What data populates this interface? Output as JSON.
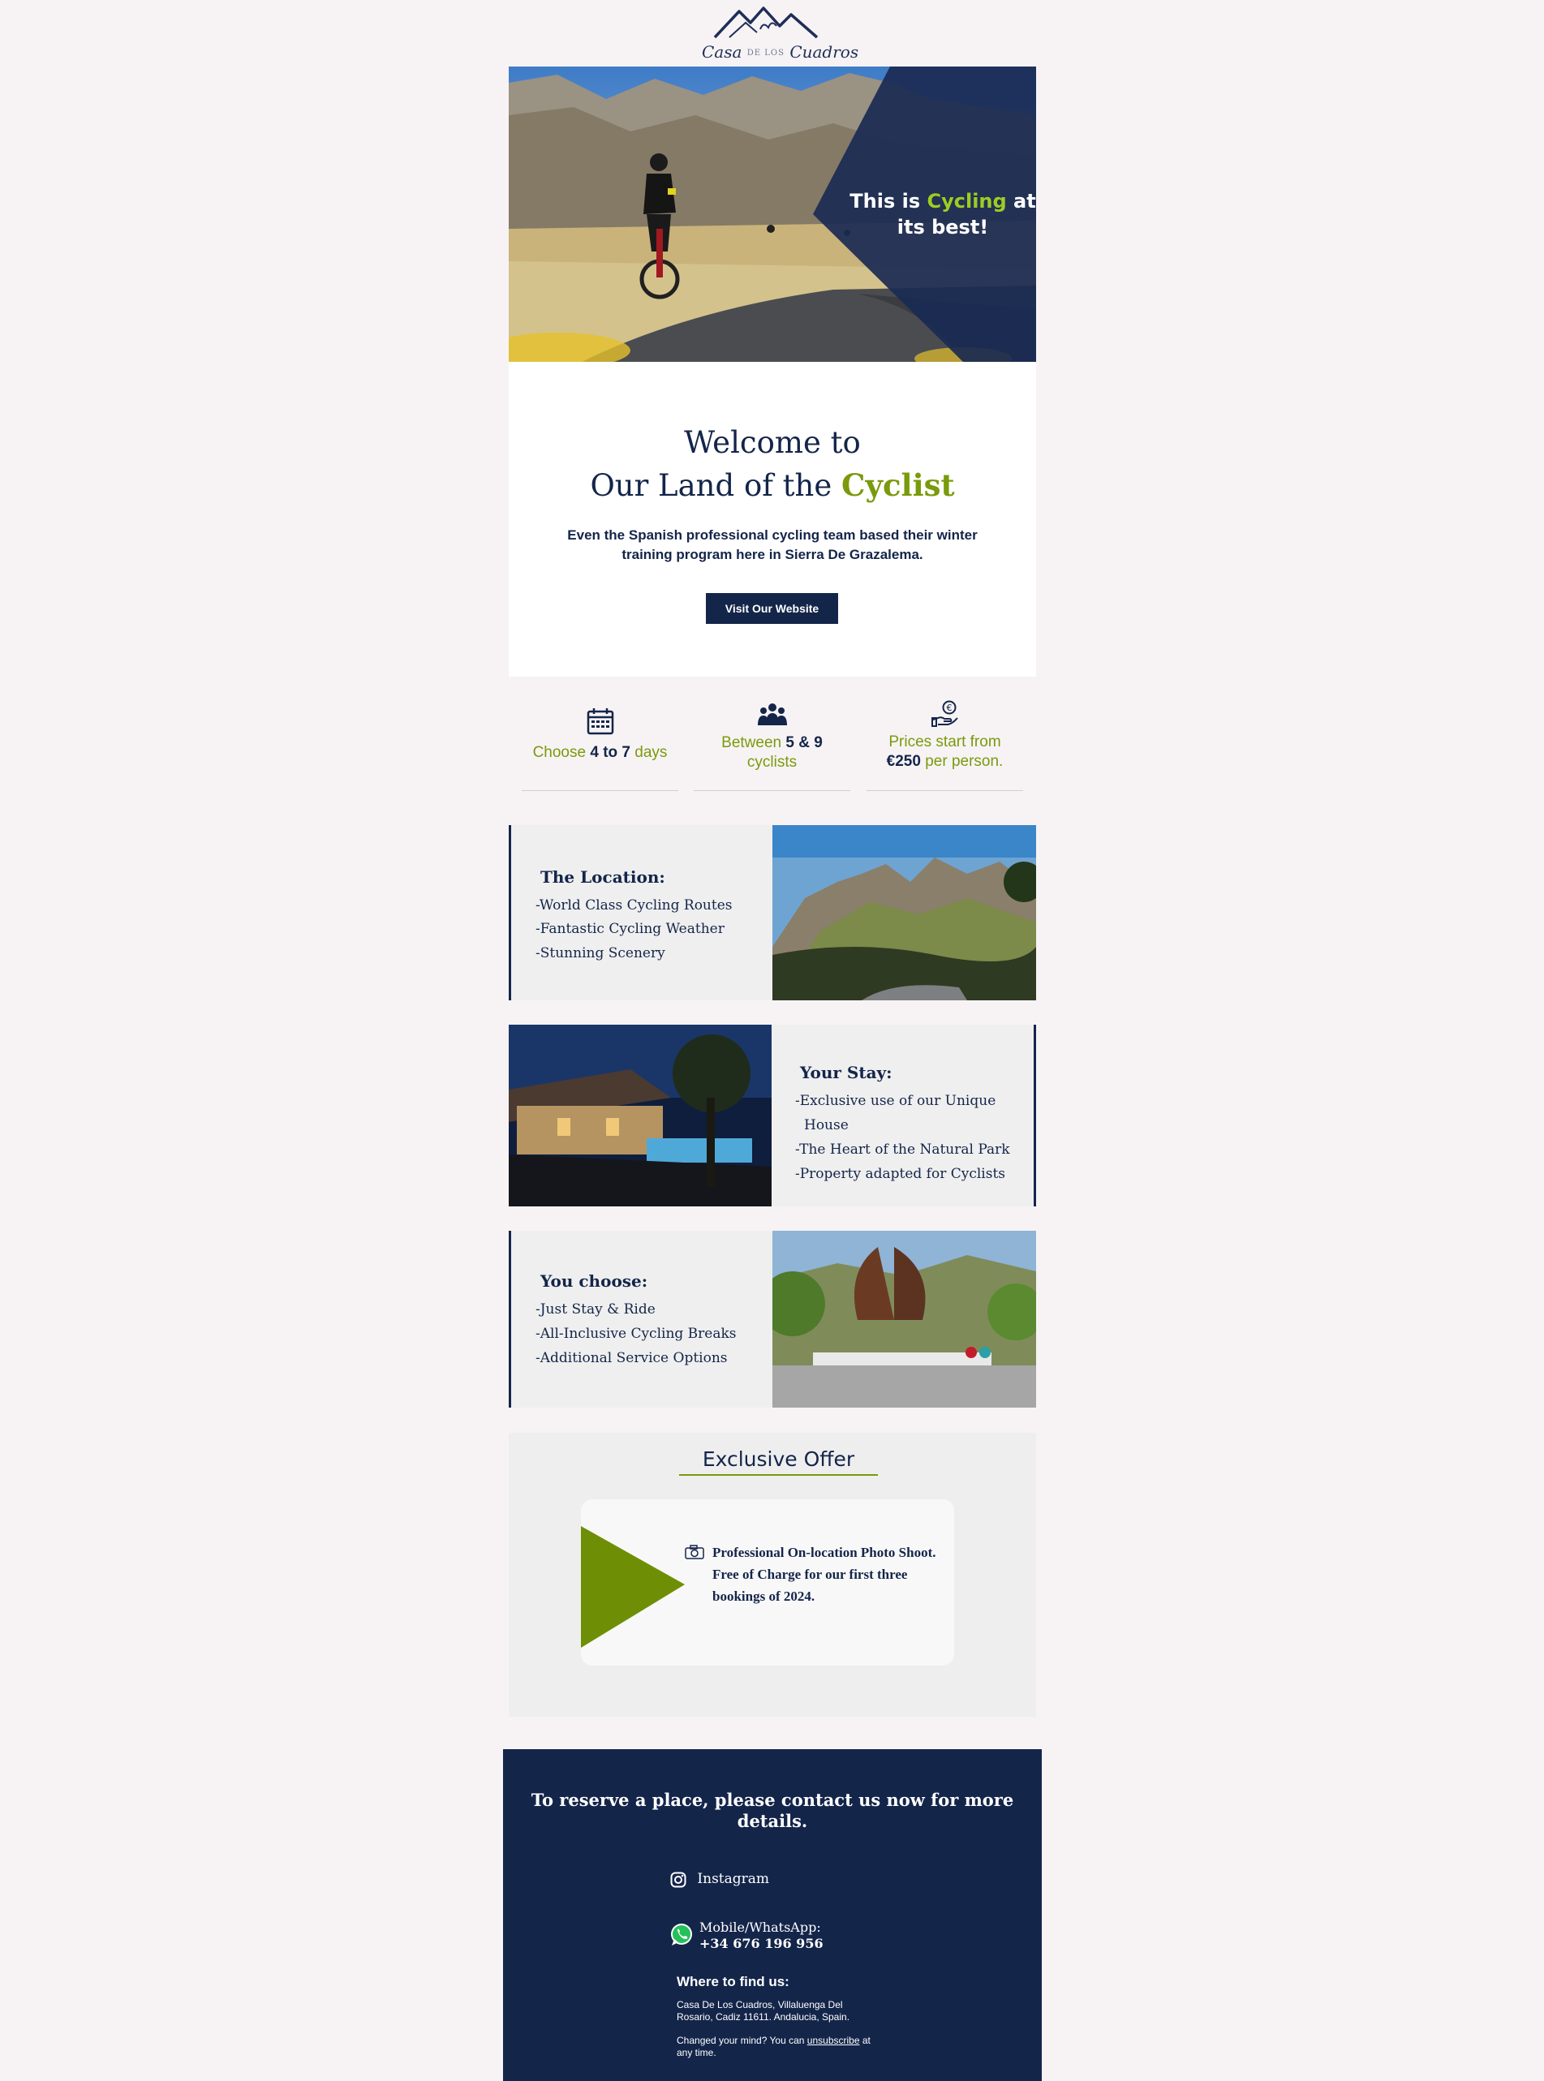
{
  "header": {
    "brand_left": "Casa",
    "brand_mid": "DE LOS",
    "brand_right": "Cuadros"
  },
  "hero": {
    "line_a": "This is ",
    "accent": "Cycling",
    "line_b": " at its best!"
  },
  "welcome": {
    "title_line1": "Welcome to",
    "title_line2": "Our Land of the ",
    "title_accent": "Cyclist",
    "body": "Even the Spanish professional cycling team based their winter training program here in Sierra De Grazalema.",
    "button": "Visit Our Website"
  },
  "features": [
    {
      "icon": "calendar-icon",
      "pre": "Choose ",
      "b1": "4",
      "mid": " to ",
      "b2": "7",
      "post": " days"
    },
    {
      "icon": "group-icon",
      "pre": "Between ",
      "b1": "5",
      "mid": " & ",
      "b2": "9",
      "post": "cyclists"
    },
    {
      "icon": "euro-hand-icon",
      "pre": "Prices start from",
      "b1": "€250",
      "post": " per person."
    }
  ],
  "location": {
    "title": "The Location:",
    "items": [
      "-World Class Cycling Routes",
      "-Fantastic Cycling Weather",
      "-Stunning Scenery"
    ]
  },
  "stay": {
    "title": "Your Stay:",
    "items": [
      "-Exclusive use of our Unique",
      "House",
      "-The Heart of the Natural Park",
      "-Property adapted for Cyclists"
    ]
  },
  "choose": {
    "title": "You choose:",
    "items": [
      "-Just Stay & Ride",
      "-All-Inclusive Cycling Breaks",
      "-Additional Service Options"
    ]
  },
  "offer": {
    "title": "Exclusive Offer",
    "text": "Professional On-location Photo Shoot. Free of Charge for our first three bookings of 2024."
  },
  "footer": {
    "cta": "To reserve a place, please contact us now for more details.",
    "instagram": "Instagram",
    "phone_label": "Mobile/WhatsApp:",
    "phone": "+34 676 196 956",
    "where_title": "Where to find us:",
    "address": "Casa De Los Cuadros, Villaluenga Del Rosario, Cadiz 11611. Andalucia, Spain.",
    "unsub_pre": "Changed your mind? You can ",
    "unsub_link": "unsubscribe",
    "unsub_post": " at any time."
  },
  "colors": {
    "navy": "#14254a",
    "green": "#7a9a0c",
    "page_bg": "#f7f3f4"
  }
}
